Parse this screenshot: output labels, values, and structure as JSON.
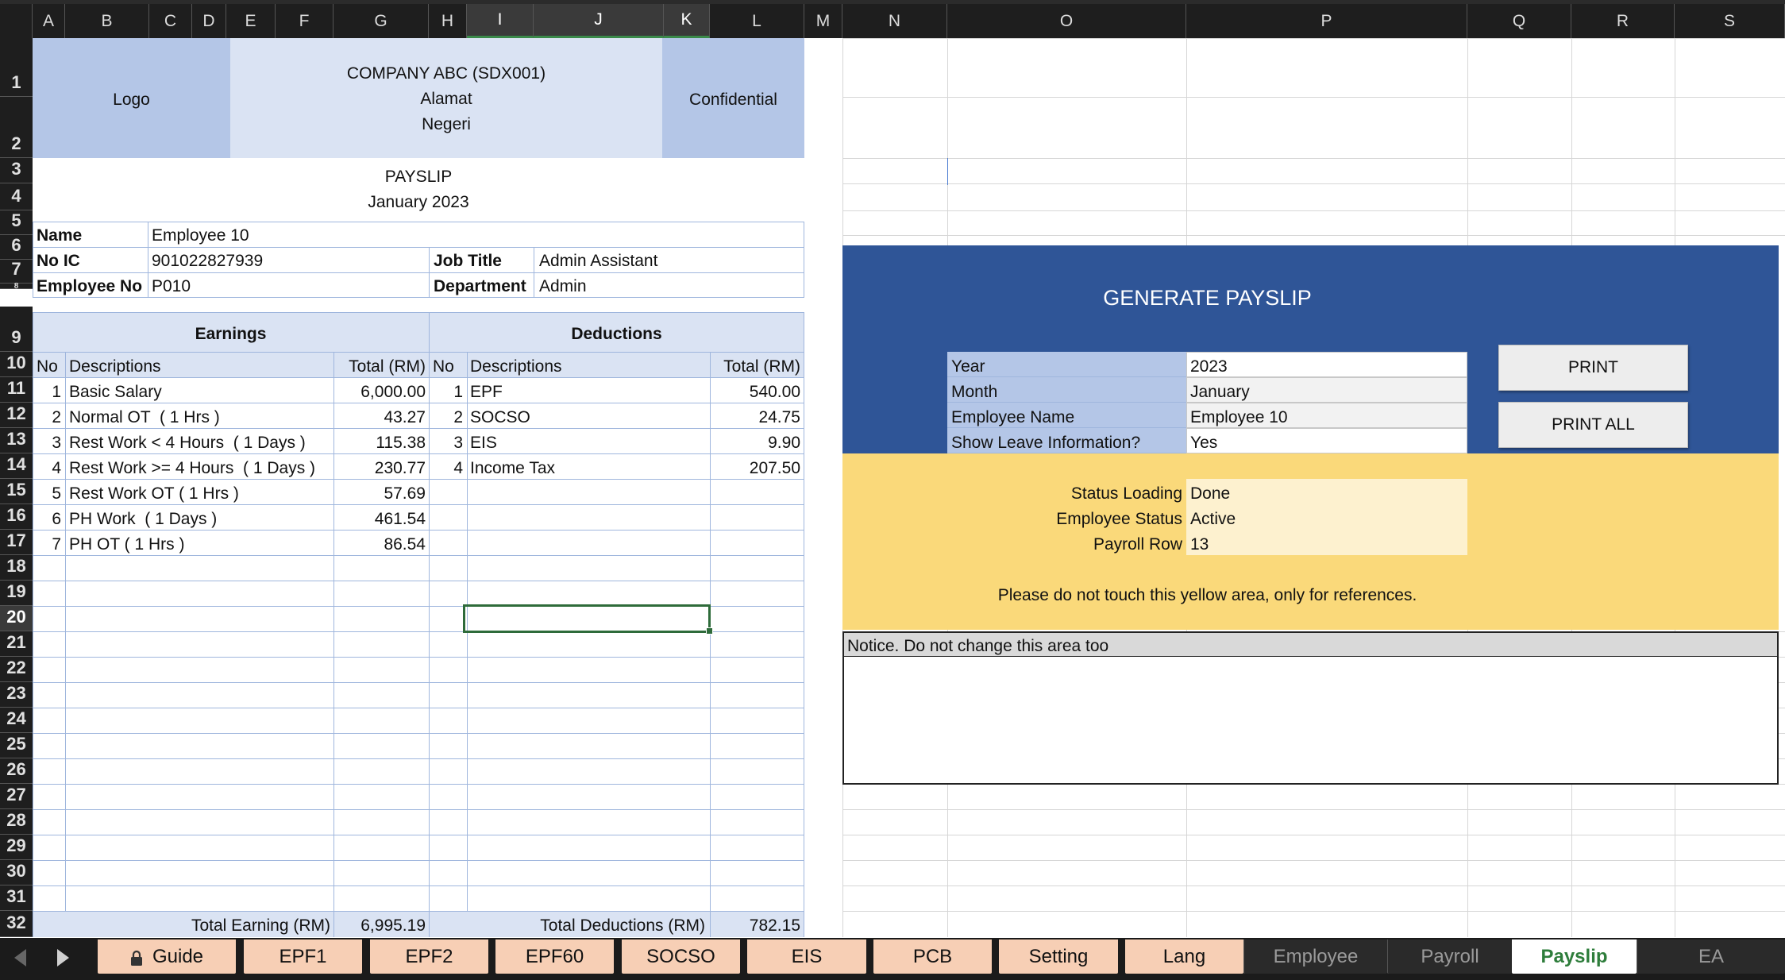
{
  "columns": [
    "A",
    "B",
    "C",
    "D",
    "E",
    "F",
    "G",
    "H",
    "I",
    "J",
    "K",
    "L",
    "M",
    "N",
    "O",
    "P",
    "Q",
    "R",
    "S"
  ],
  "rows": [
    "1",
    "2",
    "3",
    "4",
    "5",
    "6",
    "7",
    "8",
    "9",
    "10",
    "11",
    "12",
    "13",
    "14",
    "15",
    "16",
    "17",
    "18",
    "19",
    "20",
    "21",
    "22",
    "23",
    "24",
    "25",
    "26",
    "27",
    "28",
    "29",
    "30",
    "31",
    "32"
  ],
  "selected_cell": "J20",
  "header": {
    "logo": "Logo",
    "company": "COMPANY ABC (SDX001)",
    "address1": "Alamat",
    "address2": "Negeri",
    "confidential": "Confidential",
    "title": "PAYSLIP",
    "period": "January 2023"
  },
  "employee": {
    "name_label": "Name",
    "name": "Employee 10",
    "ic_label": "No IC",
    "ic": "901022827939",
    "job_label": "Job Title",
    "job": "Admin Assistant",
    "empno_label": "Employee No",
    "empno": "P010",
    "dept_label": "Department",
    "dept": "Admin"
  },
  "earnings": {
    "title": "Earnings",
    "col_no": "No",
    "col_desc": "Descriptions",
    "col_total": "Total (RM)",
    "rows": [
      {
        "no": "1",
        "desc": "Basic Salary",
        "total": "6,000.00"
      },
      {
        "no": "2",
        "desc": "Normal OT  ( 1 Hrs )",
        "total": "43.27"
      },
      {
        "no": "3",
        "desc": "Rest Work < 4 Hours  ( 1 Days )",
        "total": "115.38"
      },
      {
        "no": "4",
        "desc": "Rest Work >= 4 Hours  ( 1 Days )",
        "total": "230.77"
      },
      {
        "no": "5",
        "desc": "Rest Work OT ( 1 Hrs )",
        "total": "57.69"
      },
      {
        "no": "6",
        "desc": "PH Work  ( 1 Days )",
        "total": "461.54"
      },
      {
        "no": "7",
        "desc": "PH OT ( 1 Hrs )",
        "total": "86.54"
      }
    ],
    "total_label": "Total Earning (RM)",
    "total_value": "6,995.19"
  },
  "deductions": {
    "title": "Deductions",
    "col_no": "No",
    "col_desc": "Descriptions",
    "col_total": "Total (RM)",
    "rows": [
      {
        "no": "1",
        "desc": "EPF",
        "total": "540.00"
      },
      {
        "no": "2",
        "desc": "SOCSO",
        "total": "24.75"
      },
      {
        "no": "3",
        "desc": "EIS",
        "total": "9.90"
      },
      {
        "no": "4",
        "desc": "Income Tax",
        "total": "207.50"
      }
    ],
    "total_label": "Total Deductions (RM)",
    "total_value": "782.15"
  },
  "generator": {
    "title": "GENERATE PAYSLIP",
    "fields": [
      {
        "label": "Year",
        "value": "2023"
      },
      {
        "label": "Month",
        "value": "January"
      },
      {
        "label": "Employee Name",
        "value": "Employee 10"
      },
      {
        "label": "Show Leave Information?",
        "value": "Yes"
      }
    ],
    "print": "PRINT",
    "print_all": "PRINT ALL",
    "status": [
      {
        "label": "Status Loading",
        "value": "Done"
      },
      {
        "label": "Employee Status",
        "value": "Active"
      },
      {
        "label": "Payroll Row",
        "value": "13"
      }
    ],
    "yellow_note": "Please do not touch this yellow area, only for references.",
    "notice": "Notice. Do not change this area too"
  },
  "tabs": [
    {
      "label": "Guide",
      "locked": true,
      "style": "orange"
    },
    {
      "label": "EPF1",
      "style": "orange"
    },
    {
      "label": "EPF2",
      "style": "orange"
    },
    {
      "label": "EPF60",
      "style": "orange"
    },
    {
      "label": "SOCSO",
      "style": "orange"
    },
    {
      "label": "EIS",
      "style": "orange"
    },
    {
      "label": "PCB",
      "style": "orange"
    },
    {
      "label": "Setting",
      "style": "orange"
    },
    {
      "label": "Lang",
      "style": "orange"
    },
    {
      "label": "Employee",
      "style": "dark"
    },
    {
      "label": "Payroll",
      "style": "dark"
    },
    {
      "label": "Payslip",
      "style": "active"
    },
    {
      "label": "EA",
      "style": "dark"
    }
  ],
  "colors": {
    "header_blue": "#b4c6e7",
    "header_light": "#dae3f3",
    "generate_blue": "#2f5597",
    "yellow": "#fad97a",
    "yellow_light": "#fdf1cf",
    "tab_orange": "#f7cfb5",
    "active_tab_text": "#2e7d3b"
  }
}
